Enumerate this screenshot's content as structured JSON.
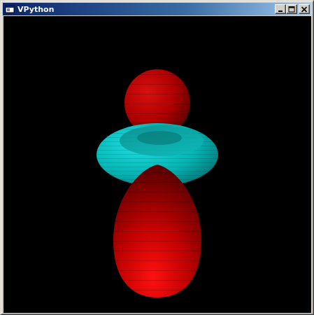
{
  "window": {
    "title": "VPython",
    "buttons": {
      "minimize": "minimize-icon",
      "maximize": "maximize-icon",
      "close": "close-icon"
    }
  },
  "scene": {
    "background": "#000000",
    "objects": [
      {
        "name": "upper-lobe",
        "shape": "ellipsoid",
        "color": "#cc0000"
      },
      {
        "name": "torus-ring",
        "shape": "torus",
        "color": "#00c8c8"
      },
      {
        "name": "lower-lobe",
        "shape": "ellipsoid",
        "color": "#dd0000"
      }
    ]
  }
}
